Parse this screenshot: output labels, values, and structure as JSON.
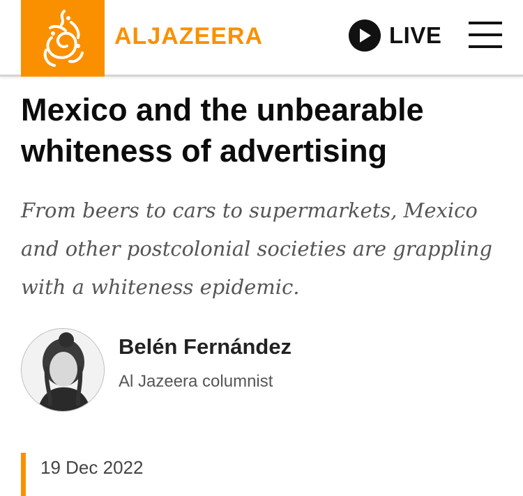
{
  "header": {
    "brand": "ALJAZEERA",
    "logo_icon": "al-jazeera-calligraphy-logo",
    "live_label": "LIVE",
    "live_icon": "play-circle-icon",
    "menu_icon": "hamburger-menu-icon"
  },
  "article": {
    "title": "Mexico and the unbearable whiteness of advertising",
    "dek": "From beers to cars to supermarkets, Mexico and other postcolonial societies are grappling with a whiteness epidemic.",
    "author": {
      "name": "Belén Fernández",
      "role": "Al Jazeera columnist"
    },
    "date": "19 Dec 2022"
  },
  "colors": {
    "brand_orange": "#fa9000",
    "text_dark": "#0c0c0c",
    "text_muted": "#555555"
  }
}
